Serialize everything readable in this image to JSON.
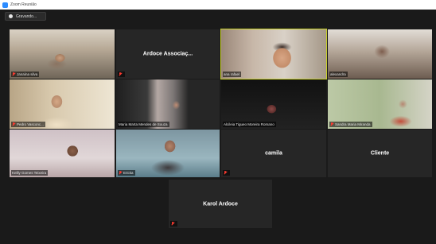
{
  "window": {
    "title": "Zoom Reunião"
  },
  "recording": {
    "label": "Gravando..."
  },
  "participants": [
    {
      "name": "Janaína silva",
      "muted": true,
      "has_video": true
    },
    {
      "name": "Ardoce Associaç...",
      "muted": true,
      "has_video": false
    },
    {
      "name": "ana rafael",
      "muted": false,
      "has_video": true,
      "active_speaker": true
    },
    {
      "name": "alexandra",
      "muted": false,
      "has_video": true
    },
    {
      "name": "Pedro Vasconc...",
      "muted": true,
      "has_video": true
    },
    {
      "name": "Maria Marta Mendes de Souza",
      "muted": false,
      "has_video": true
    },
    {
      "name": "Alcileia Tigueo Moreira Romano",
      "muted": false,
      "has_video": true
    },
    {
      "name": "Sandra Maria Miranda",
      "muted": true,
      "has_video": true
    },
    {
      "name": "Keilly Gomes Teixeira",
      "muted": false,
      "has_video": true
    },
    {
      "name": "Ericka",
      "muted": true,
      "has_video": true
    },
    {
      "name": "camila",
      "muted": true,
      "has_video": false
    },
    {
      "name": "Cliente",
      "muted": false,
      "has_video": false
    },
    {
      "name": "Karol Ardoce",
      "muted": true,
      "has_video": false
    }
  ],
  "colors": {
    "active_speaker_border": "#c9d12a",
    "muted_mic": "#ff3b30",
    "tile_bg": "#262626",
    "window_bg": "#1a1a1a"
  }
}
